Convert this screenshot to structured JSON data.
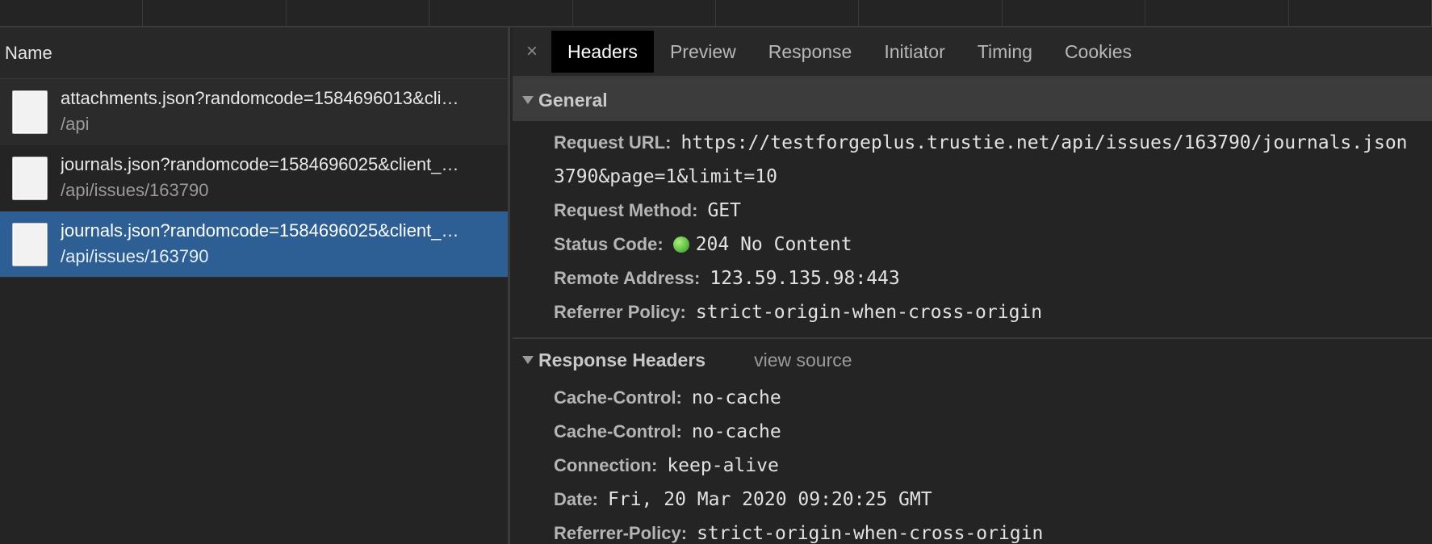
{
  "left_panel": {
    "column_header": "Name",
    "requests": [
      {
        "name": "attachments.json?randomcode=1584696013&cli…",
        "path": "/api",
        "selected": false
      },
      {
        "name": "journals.json?randomcode=1584696025&client_…",
        "path": "/api/issues/163790",
        "selected": false
      },
      {
        "name": "journals.json?randomcode=1584696025&client_…",
        "path": "/api/issues/163790",
        "selected": true
      }
    ]
  },
  "tabs": {
    "close": "×",
    "items": [
      "Headers",
      "Preview",
      "Response",
      "Initiator",
      "Timing",
      "Cookies"
    ],
    "active": "Headers"
  },
  "general": {
    "title": "General",
    "request_url_label": "Request URL:",
    "request_url_value": "https://testforgeplus.trustie.net/api/issues/163790/journals.json",
    "request_url_cont": "3790&page=1&limit=10",
    "request_method_label": "Request Method:",
    "request_method_value": "GET",
    "status_code_label": "Status Code:",
    "status_code_value": "204 No Content",
    "remote_address_label": "Remote Address:",
    "remote_address_value": "123.59.135.98:443",
    "referrer_policy_label": "Referrer Policy:",
    "referrer_policy_value": "strict-origin-when-cross-origin"
  },
  "response_headers": {
    "title": "Response Headers",
    "view_source": "view source",
    "items": [
      {
        "key": "Cache-Control:",
        "value": "no-cache"
      },
      {
        "key": "Cache-Control:",
        "value": "no-cache"
      },
      {
        "key": "Connection:",
        "value": "keep-alive"
      },
      {
        "key": "Date:",
        "value": "Fri, 20 Mar 2020 09:20:25 GMT"
      },
      {
        "key": "Referrer-Policy:",
        "value": "strict-origin-when-cross-origin"
      }
    ]
  },
  "colors": {
    "selected_row": "#2d5f94",
    "status_ok": "#3fb52a",
    "active_tab_bg": "#000000"
  }
}
